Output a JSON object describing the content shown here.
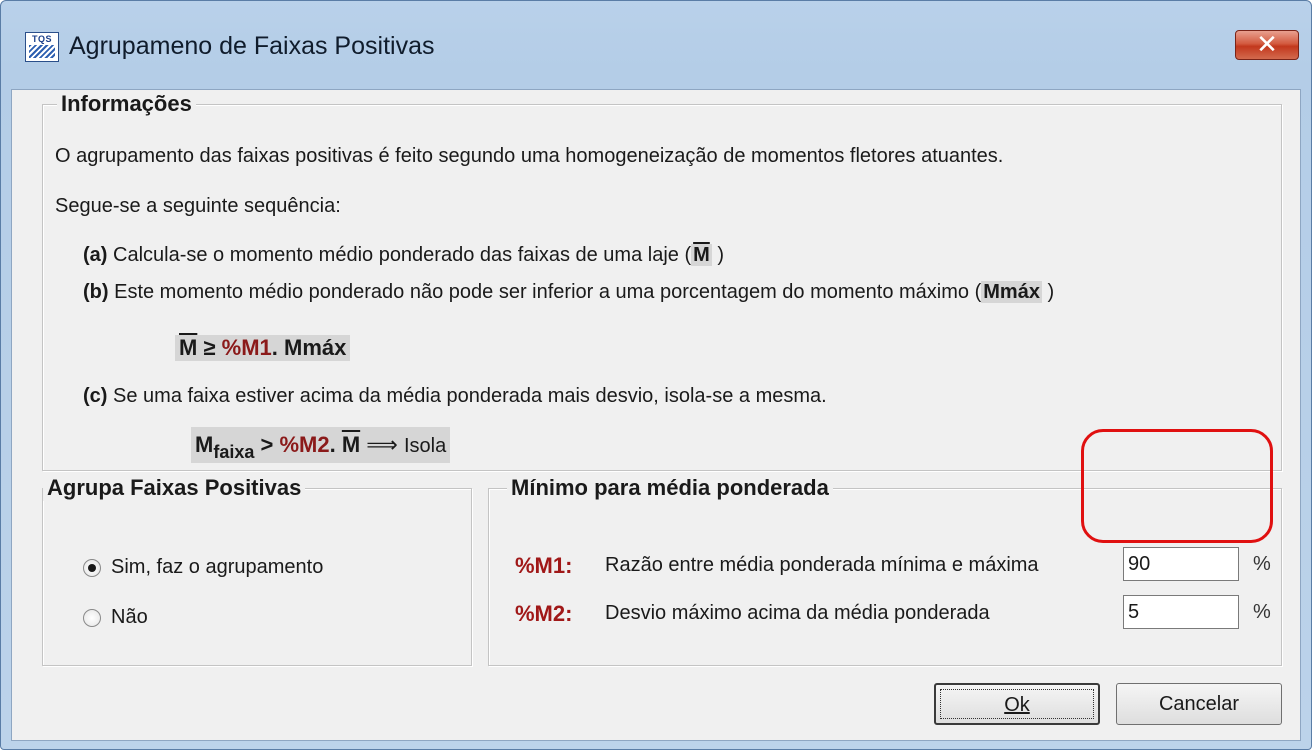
{
  "window": {
    "title": "Agrupameno de Faixas Positivas",
    "icon_text": "TQS",
    "close_glyph": "✕"
  },
  "info": {
    "title": "Informações",
    "line1": "O agrupamento das faixas positivas é feito segundo uma homogeneização de momentos fletores atuantes.",
    "line2": "Segue-se a seguinte sequência:",
    "a_label": "(a)",
    "a_text": "Calcula-se o momento médio ponderado das faixas de uma laje (",
    "a_sym": "M",
    "a_close": ")",
    "b_label": "(b)",
    "b_text": "Este momento médio ponderado não pode ser inferior a uma porcentagem do momento máximo (",
    "b_sym": "Mmáx",
    "b_close": ")",
    "formula1": {
      "m": "M",
      "op": "≥",
      "pct": "%M1",
      "dot": ".",
      "mmax": "Mmáx"
    },
    "c_label": "(c)",
    "c_text": "Se uma faixa estiver acima da média ponderada mais desvio, isola-se a mesma.",
    "formula2": {
      "m": "M",
      "sub": "faixa",
      "op": ">",
      "pct": "%M2",
      "dot": ".",
      "mbar": "M",
      "arrow": "⟹",
      "isola": "Isola"
    }
  },
  "agrupa": {
    "title": "Agrupa Faixas Positivas",
    "options": [
      {
        "label": "Sim, faz o agrupamento",
        "checked": true
      },
      {
        "label": "Não",
        "checked": false
      }
    ]
  },
  "minimo": {
    "title": "Mínimo para média ponderada",
    "m1_label": "%M1:",
    "m1_desc": "Razão entre média ponderada mínima e máxima",
    "m1_value": "90",
    "m1_unit": "%",
    "m2_label": "%M2:",
    "m2_desc": "Desvio máximo acima da média ponderada",
    "m2_value": "5",
    "m2_unit": "%"
  },
  "buttons": {
    "ok": "Ok",
    "cancel": "Cancelar"
  },
  "colors": {
    "accent_red": "#a01818",
    "highlight_ring": "#e01010",
    "close_button": "#c2381d"
  }
}
